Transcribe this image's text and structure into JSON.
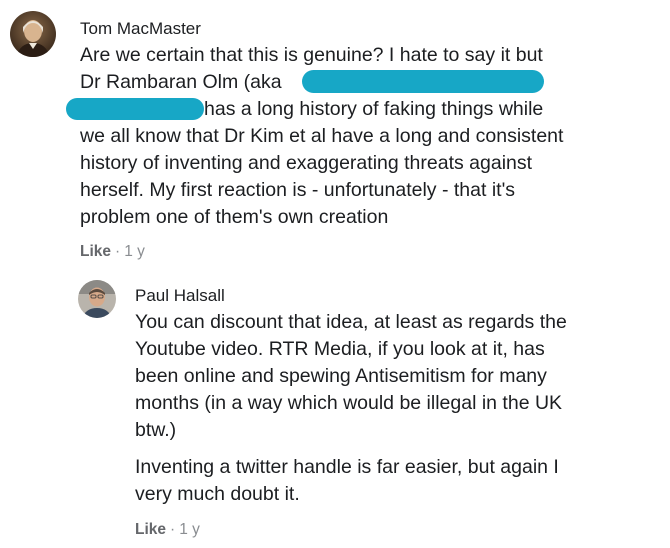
{
  "comments": [
    {
      "author": "Tom MacMaster",
      "lines": [
        "Are we certain that this is genuine? I hate to say it but",
        "Dr Rambaran Olm (aka",
        "has a long history of faking things while",
        "we all know that Dr Kim et al have a long and consistent",
        "history of inventing and exaggerating threats against",
        "herself. My first reaction is - unfortunately - that it's",
        "problem one of them's own creation"
      ],
      "like_label": "Like",
      "time": "1 y",
      "avatar_icon": "portrait-avatar-icon"
    },
    {
      "author": "Paul Halsall",
      "paragraph1": [
        "You can discount that idea, at least as regards the",
        "Youtube video. RTR Media, if you look at it, has",
        "been online and spewing Antisemitism for many",
        "months (in a way which would be illegal in the UK",
        "btw.)"
      ],
      "paragraph2": [
        "Inventing a twitter handle is far easier, but again I",
        "very much doubt it."
      ],
      "like_label": "Like",
      "time": "1 y",
      "avatar_icon": "man-avatar-icon"
    }
  ],
  "colors": {
    "redaction": "#17a7c6",
    "meta_text": "#8a8d91",
    "body_text": "#1c1e21"
  }
}
